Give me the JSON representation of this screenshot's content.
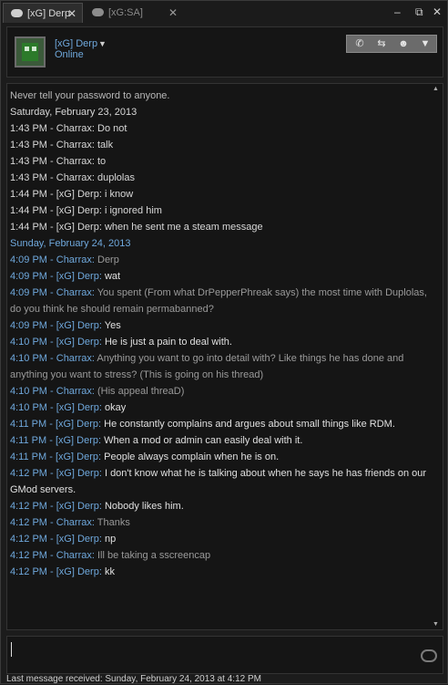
{
  "tabs": [
    {
      "label": "[xG] Derp",
      "close": "✕"
    },
    {
      "label": "[xG:SA] Scooter",
      "close": "✕"
    }
  ],
  "window_controls": {
    "minimize": "–",
    "restore": "⧉",
    "close": "✕"
  },
  "header": {
    "name": "[xG] Derp",
    "status": "Online",
    "dropdown": "▼",
    "actions": [
      {
        "icon": "phone-icon",
        "glyph": "✆"
      },
      {
        "icon": "transfer-icon",
        "glyph": "⇆"
      },
      {
        "icon": "group-icon",
        "glyph": "☻"
      },
      {
        "icon": "chevron-down-icon",
        "glyph": "▼"
      }
    ]
  },
  "log": {
    "notice": "Never tell your password to anyone.",
    "date1": "Saturday, February 23, 2013",
    "date2": "Sunday, February 24, 2013",
    "lines1": [
      {
        "time": "1:43 PM",
        "sep": " - ",
        "name": "Charrax",
        "msg": "Do not"
      },
      {
        "time": "1:43 PM",
        "sep": " - ",
        "name": "Charrax",
        "msg": "talk"
      },
      {
        "time": "1:43 PM",
        "sep": " - ",
        "name": "Charrax",
        "msg": "to"
      },
      {
        "time": "1:43 PM",
        "sep": " - ",
        "name": "Charrax",
        "msg": "duplolas"
      },
      {
        "time": "1:44 PM",
        "sep": " - ",
        "name": "[xG] Derp",
        "msg": "i know"
      },
      {
        "time": "1:44 PM",
        "sep": " - ",
        "name": "[xG] Derp",
        "msg": "i ignored him"
      },
      {
        "time": "1:44 PM",
        "sep": " - ",
        "name": "[xG] Derp",
        "msg": "when he sent me a steam message"
      }
    ],
    "lines2": [
      {
        "time": "4:09 PM",
        "name": "Charrax",
        "msg": "Derp",
        "dim": true
      },
      {
        "time": "4:09 PM",
        "name": "[xG] Derp",
        "msg": "wat",
        "dim": false
      },
      {
        "time": "4:09 PM",
        "name": "Charrax",
        "msg": "You spent (From what DrPepperPhreak says) the most time with Duplolas, do you think he should remain permabanned?",
        "dim": true
      },
      {
        "time": "4:09 PM",
        "name": "[xG] Derp",
        "msg": "Yes",
        "dim": false
      },
      {
        "time": "4:10 PM",
        "name": "[xG] Derp",
        "msg": "He is just a pain to deal with.",
        "dim": false
      },
      {
        "time": "4:10 PM",
        "name": "Charrax",
        "msg": "Anything you want to go into detail with? Like things he has done and anything you want to stress? (This is going on his thread)",
        "dim": true
      },
      {
        "time": "4:10 PM",
        "name": "Charrax",
        "msg": "(His appeal threaD)",
        "dim": true
      },
      {
        "time": "4:10 PM",
        "name": "[xG] Derp",
        "msg": "okay",
        "dim": false
      },
      {
        "time": "4:11 PM",
        "name": "[xG] Derp",
        "msg": "He constantly complains and argues about small things like RDM.",
        "dim": false
      },
      {
        "time": "4:11 PM",
        "name": "[xG] Derp",
        "msg": "When a mod or admin can easily deal with it.",
        "dim": false
      },
      {
        "time": "4:11 PM",
        "name": "[xG] Derp",
        "msg": "People always complain when he is on.",
        "dim": false
      },
      {
        "time": "4:12 PM",
        "name": "[xG] Derp",
        "msg": "I don't know what he is talking about when he says he has friends on our GMod servers.",
        "dim": false
      },
      {
        "time": "4:12 PM",
        "name": "[xG] Derp",
        "msg": "Nobody likes him.",
        "dim": false
      },
      {
        "time": "4:12 PM",
        "name": "Charrax",
        "msg": "Thanks",
        "dim": true
      },
      {
        "time": "4:12 PM",
        "name": "[xG] Derp",
        "msg": "np",
        "dim": false
      },
      {
        "time": "4:12 PM",
        "name": "Charrax",
        "msg": "Ill be taking a sscreencap",
        "dim": true
      },
      {
        "time": "4:12 PM",
        "name": "[xG] Derp",
        "msg": "kk",
        "dim": false
      }
    ]
  },
  "footer": "Last message received: Sunday, February 24, 2013 at 4:12 PM",
  "colors": {
    "accent": "#6fa8dc",
    "text": "#d8d8d8",
    "background": "#151515"
  }
}
